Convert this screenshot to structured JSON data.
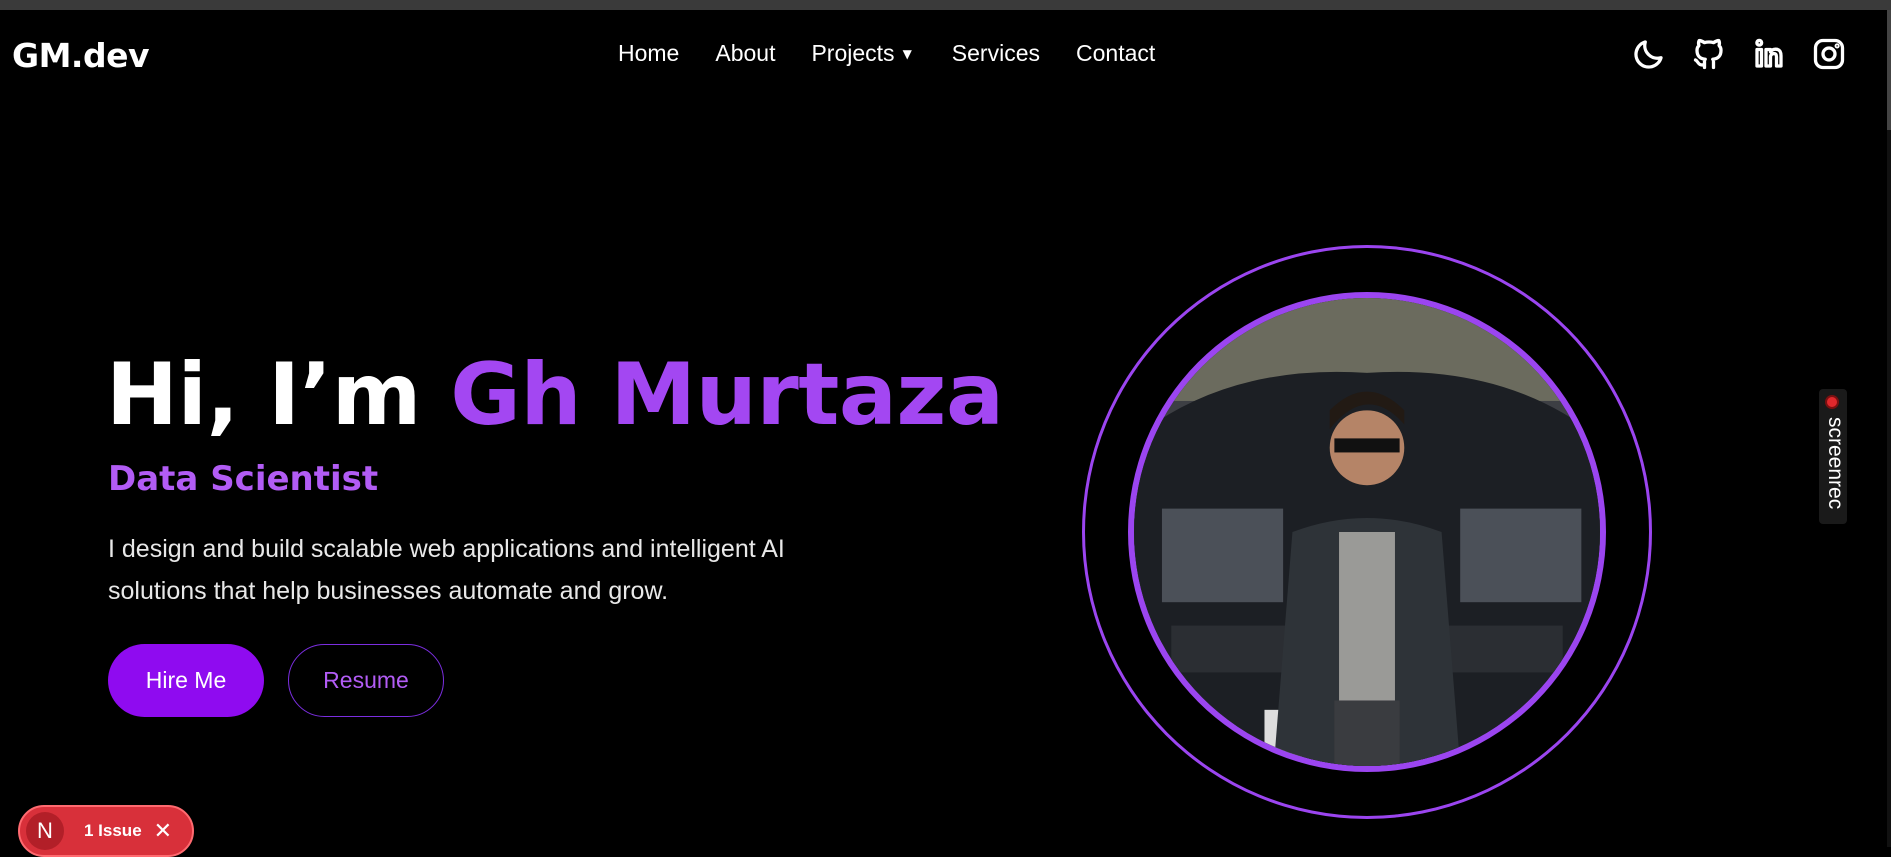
{
  "brand": {
    "logo": "GM.dev"
  },
  "nav": {
    "home": "Home",
    "about": "About",
    "projects": "Projects",
    "services": "Services",
    "contact": "Contact"
  },
  "social": [
    "moon-icon",
    "github-icon",
    "linkedin-icon",
    "instagram-icon"
  ],
  "hero": {
    "greeting": "Hi, I’m",
    "name": "Gh Murtaza",
    "role": "Data Scientist",
    "description": "I design and build scalable web applications and intelligent AI solutions that help businesses automate and grow.",
    "hire_label": "Hire Me",
    "resume_label": "Resume"
  },
  "overlay": {
    "screenrec_label": "screenrec",
    "issue_initial": "N",
    "issue_label": "1 Issue"
  },
  "colors": {
    "accent": "#a347f2",
    "button": "#8f0bf0",
    "background": "#000000",
    "issue": "#d8303a"
  }
}
